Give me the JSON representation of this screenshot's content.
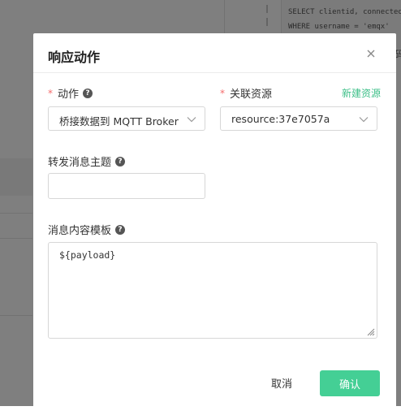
{
  "background": {
    "sql_lines": [
      "SELECT clientid, connected_",
      "WHERE username = 'emqx'"
    ],
    "side_fragment": "码"
  },
  "dialog": {
    "title": "响应动作",
    "close_icon": "close-icon",
    "action": {
      "label": "动作",
      "required_mark": "*",
      "value": "桥接数据到 MQTT Broker"
    },
    "resource": {
      "label": "关联资源",
      "required_mark": "*",
      "value": "resource:37e7057a",
      "new_link": "新建资源"
    },
    "topic": {
      "label": "转发消息主题",
      "value": ""
    },
    "template": {
      "label": "消息内容模板",
      "value": "${payload}"
    },
    "buttons": {
      "cancel": "取消",
      "confirm": "确认"
    }
  },
  "colors": {
    "accent": "#44cf95",
    "link": "#3dbf88",
    "required": "#f56c6c",
    "overlay": "rgba(0,0,0,0.5)"
  }
}
